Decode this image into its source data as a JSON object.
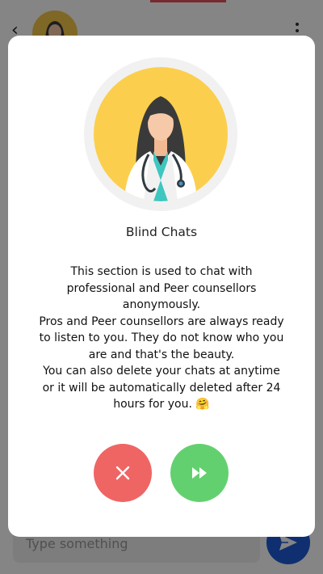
{
  "composer": {
    "placeholder": "Type something"
  },
  "dialog": {
    "title": "Blind Chats",
    "body_lines": [
      "This section is used to chat with professional and Peer counsellors anonymously.",
      "Pros and Peer counsellors are always ready to listen to you. They do not know who you are and that's the beauty.",
      "You can also delete your chats at anytime or it will be automatically deleted after 24 hours for you. 🤗"
    ],
    "close_icon": "close-icon",
    "continue_icon": "fast-forward-icon"
  },
  "icons": {
    "back": "back-arrow-icon",
    "menu": "kebab-menu-icon",
    "send": "send-icon"
  },
  "colors": {
    "close_button": "#ef6564",
    "continue_button": "#63d06f",
    "send_button": "#1e5bd6",
    "avatar_bg": "#fbcf4d"
  }
}
